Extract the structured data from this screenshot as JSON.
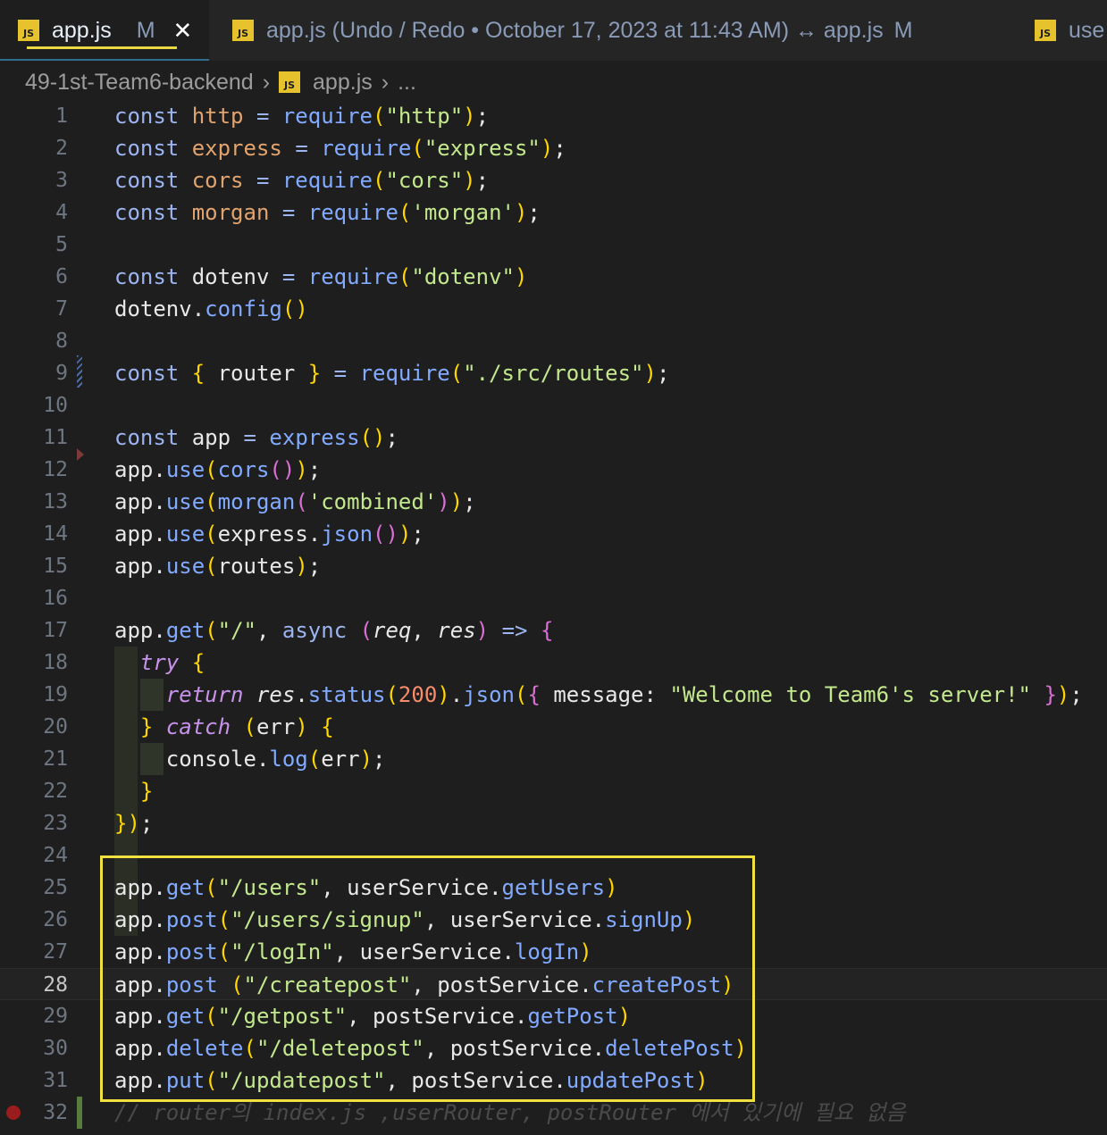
{
  "tabs": [
    {
      "icon": "JS",
      "label": "app.js",
      "status": "M",
      "close": "✕"
    },
    {
      "icon": "JS",
      "label": "app.js (Undo / Redo • October 17, 2023 at 11:43 AM) ↔ app.js",
      "status": "M"
    },
    {
      "icon": "JS",
      "label": "use"
    }
  ],
  "breadcrumb": {
    "folder": "49-1st-Team6-backend",
    "file": "app.js",
    "more": "..."
  },
  "code": {
    "line_numbers": [
      "1",
      "2",
      "3",
      "4",
      "5",
      "6",
      "7",
      "8",
      "9",
      "10",
      "11",
      "12",
      "13",
      "14",
      "15",
      "16",
      "17",
      "18",
      "19",
      "20",
      "21",
      "22",
      "23",
      "24",
      "25",
      "26",
      "27",
      "28",
      "29",
      "30",
      "31",
      "32"
    ],
    "current_line": "28",
    "lines": [
      "const http = require(\"http\");",
      "const express = require(\"express\");",
      "const cors = require(\"cors\");",
      "const morgan = require('morgan');",
      "",
      "const dotenv = require(\"dotenv\")",
      "dotenv.config()",
      "",
      "const { router } = require(\"./src/routes\");",
      "",
      "const app = express();",
      "app.use(cors());",
      "app.use(morgan('combined'));",
      "app.use(express.json());",
      "app.use(routes);",
      "",
      "app.get(\"/\", async (req, res) => {",
      "  try {",
      "    return res.status(200).json({ message: \"Welcome to Team6's server!\" });",
      "  } catch (err) {",
      "    console.log(err);",
      "  }",
      "});",
      "",
      "app.get(\"/users\", userService.getUsers)",
      "app.post(\"/users/signup\", userService.signUp)",
      "app.post(\"/logIn\", userService.logIn)",
      "app.post (\"/createpost\", postService.createPost)",
      "app.get(\"/getpost\", postService.getPost)",
      "app.delete(\"/deletepost\", postService.deletePost)",
      "app.put(\"/updatepost\", postService.updatePost)",
      "// router의 index.js ,userRouter, postRouter 에서 있기에 필요 없음"
    ]
  },
  "colors": {
    "background": "#1e1e1e",
    "highlight_box": "#f0e040",
    "js_badge": "#e6c22c"
  }
}
